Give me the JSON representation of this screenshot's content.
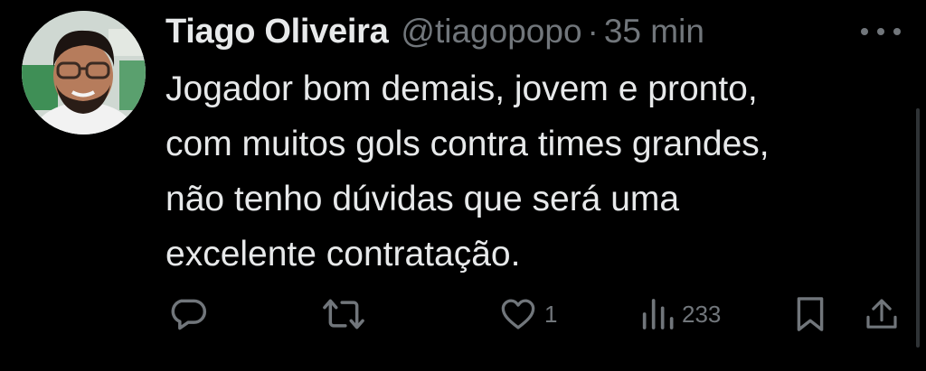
{
  "tweet": {
    "author_name": "Tiago Oliveira",
    "handle": "@tiagopopo",
    "separator": "·",
    "time": "35 min",
    "text_lines": [
      "Jogador bom demais, jovem e pronto,",
      "com muitos gols contra times grandes,",
      "não tenho dúvidas que será uma",
      "excelente contratação."
    ]
  },
  "actions": {
    "reply_icon": "reply-icon",
    "retweet_icon": "retweet-icon",
    "like_icon": "heart-icon",
    "like_count": "1",
    "views_icon": "views-icon",
    "views_count": "233",
    "bookmark_icon": "bookmark-icon",
    "share_icon": "share-icon"
  },
  "colors": {
    "background": "#000000",
    "primary_text": "#e7e9ea",
    "secondary_text": "#71767b"
  }
}
